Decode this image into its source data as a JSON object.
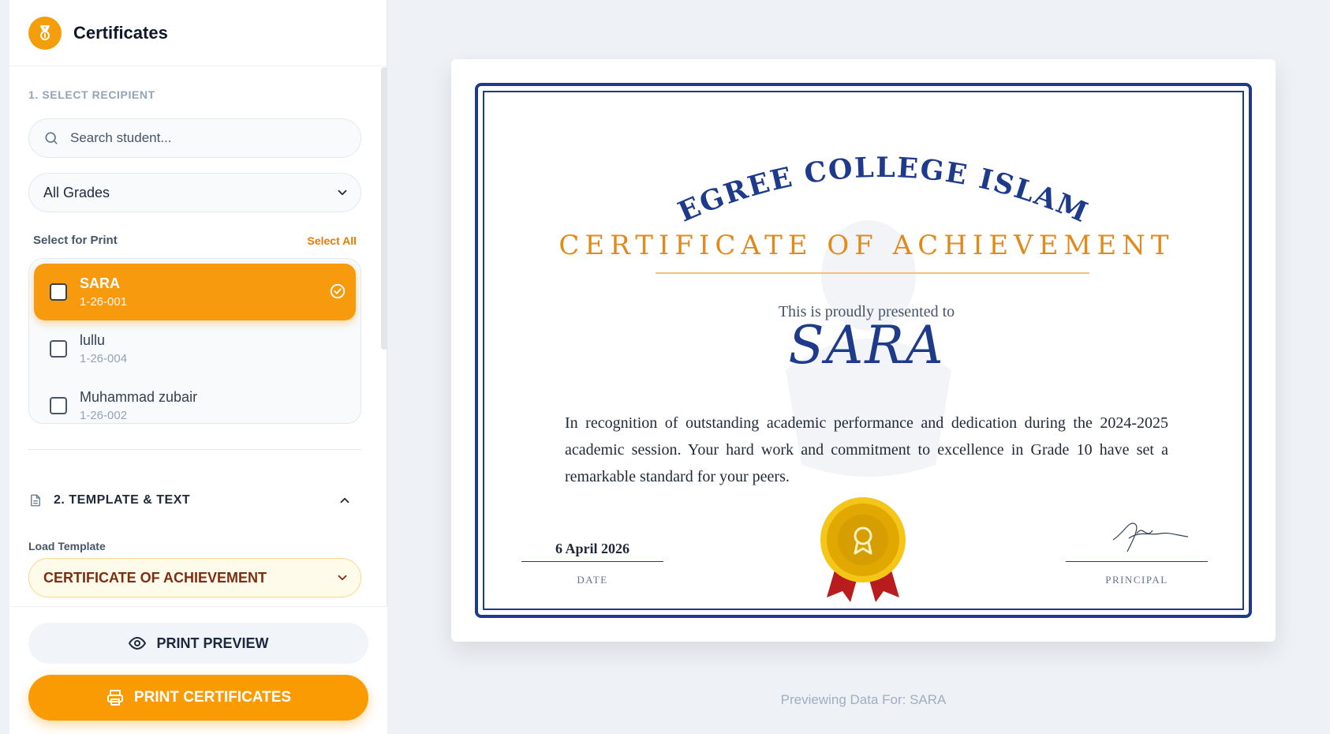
{
  "sidebar": {
    "title": "Certificates",
    "logo_icon": "medal-icon",
    "step1_label": "1. SELECT RECIPIENT",
    "search_placeholder": "Search student...",
    "grade_filter": "All Grades",
    "select_for_print_label": "Select for Print",
    "select_all_label": "Select All",
    "students": [
      {
        "name": "SARA",
        "id": "1-26-001",
        "highlighted": true,
        "checked": false
      },
      {
        "name": "lullu",
        "id": "1-26-004",
        "highlighted": false,
        "checked": false
      },
      {
        "name": "Muhammad zubair",
        "id": "1-26-002",
        "highlighted": false,
        "checked": false
      }
    ],
    "step2_label": "2. TEMPLATE & TEXT",
    "load_template_label": "Load Template",
    "template_value": "CERTIFICATE OF ACHIEVEMENT",
    "preview_button": "PRINT PREVIEW",
    "print_button": "PRINT CERTIFICATES"
  },
  "certificate": {
    "college_name": "DEGREE COLLEGE ISLAMA",
    "heading": "CERTIFICATE OF ACHIEVEMENT",
    "presented_text": "This is proudly presented to",
    "recipient_name": "SARA",
    "body": "In recognition of outstanding academic performance and dedication during the 2024-2025 academic session. Your hard work and commitment to excellence in Grade 10 have set a remarkable standard for your peers.",
    "date_value": "6 April 2026",
    "date_label": "DATE",
    "principal_label": "PRINCIPAL"
  },
  "preview_note": "Previewing Data For: SARA",
  "colors": {
    "accent_orange": "#f79a0e",
    "navy": "#1e3a8a",
    "gold": "#e08a1c"
  }
}
